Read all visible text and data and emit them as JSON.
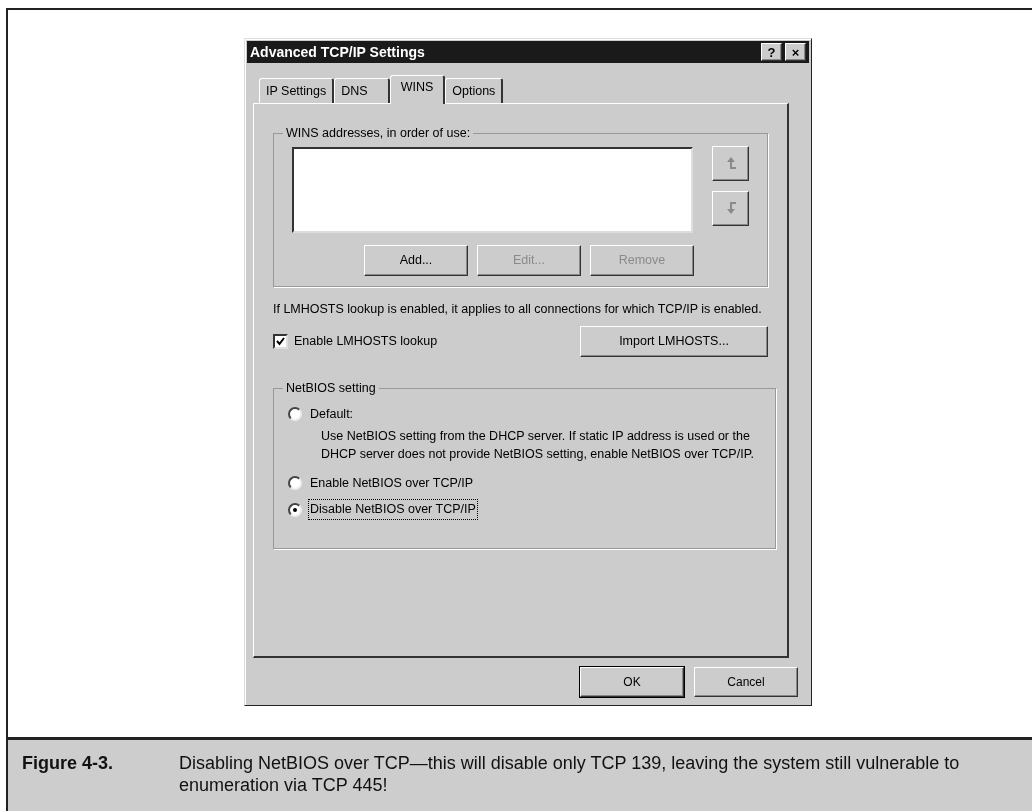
{
  "dialog": {
    "title": "Advanced TCP/IP Settings",
    "title_buttons": [
      "?",
      "×"
    ],
    "tabs": [
      {
        "label": "IP Settings",
        "selected": false
      },
      {
        "label": "DNS",
        "selected": false
      },
      {
        "label": "WINS",
        "selected": true
      },
      {
        "label": "Options",
        "selected": false
      }
    ],
    "wins_group": {
      "title": "WINS addresses, in order of use:",
      "move_buttons": [
        {
          "kind": "up",
          "disabled": true
        },
        {
          "kind": "down",
          "disabled": true
        }
      ],
      "buttons": [
        {
          "label": "Add...",
          "disabled": false
        },
        {
          "label": "Edit...",
          "disabled": true
        },
        {
          "label": "Remove",
          "disabled": true
        }
      ]
    },
    "lmhosts_note": "If LMHOSTS lookup is enabled, it applies to all connections for which TCP/IP is enabled.",
    "lmhosts_checkbox": {
      "label": "Enable LMHOSTS lookup",
      "checked": true
    },
    "import_button": "Import LMHOSTS...",
    "netbios_group": {
      "title": "NetBIOS setting",
      "options": [
        {
          "label": "Default:",
          "description": "Use NetBIOS setting from the DHCP server. If static IP address is used or the DHCP server does not provide NetBIOS setting, enable NetBIOS over TCP/IP.",
          "selected": false,
          "focused": false
        },
        {
          "label": "Enable NetBIOS over TCP/IP",
          "selected": false,
          "focused": false
        },
        {
          "label": "Disable NetBIOS over TCP/IP",
          "selected": true,
          "focused": true
        }
      ]
    },
    "footer_buttons": [
      "OK",
      "Cancel"
    ]
  },
  "caption": {
    "label": "Figure 4-3.",
    "text": "Disabling NetBIOS over TCP—this will disable only TCP 139, leaving the system still vulnerable to enumeration via TCP 445!"
  }
}
